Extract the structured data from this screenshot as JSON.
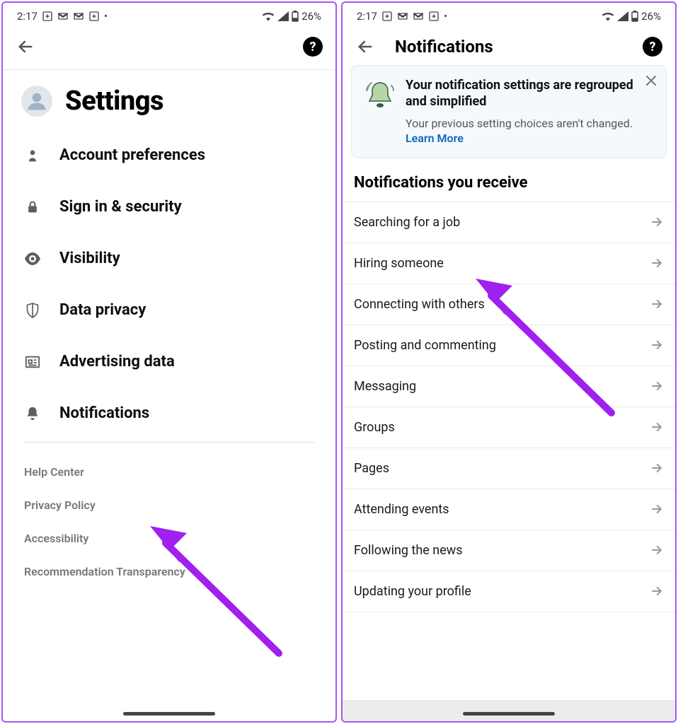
{
  "status": {
    "time": "2:17",
    "battery": "26%"
  },
  "screen1": {
    "title": "Settings",
    "items": [
      {
        "label": "Account preferences"
      },
      {
        "label": "Sign in & security"
      },
      {
        "label": "Visibility"
      },
      {
        "label": "Data privacy"
      },
      {
        "label": "Advertising data"
      },
      {
        "label": "Notifications"
      }
    ],
    "footer": [
      "Help Center",
      "Privacy Policy",
      "Accessibility",
      "Recommendation Transparency"
    ]
  },
  "screen2": {
    "title": "Notifications",
    "card": {
      "title": "Your notification settings are regrouped and simplified",
      "sub": "Your previous setting choices aren't changed.",
      "learn": "Learn More"
    },
    "section_heading": "Notifications you receive",
    "rows": [
      "Searching for a job",
      "Hiring someone",
      "Connecting with others",
      "Posting and commenting",
      "Messaging",
      "Groups",
      "Pages",
      "Attending events",
      "Following the news",
      "Updating your profile"
    ]
  }
}
